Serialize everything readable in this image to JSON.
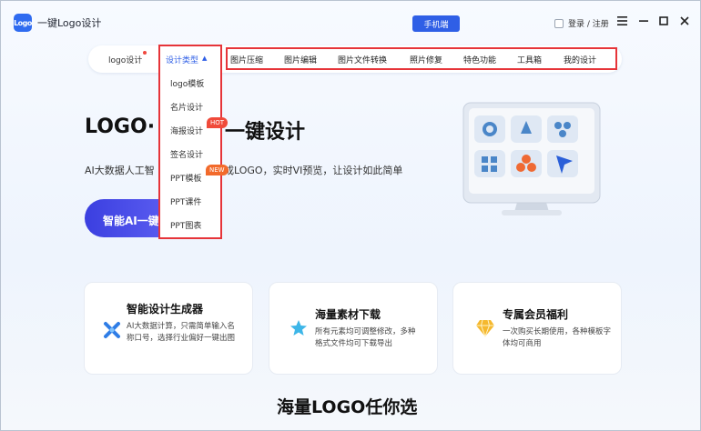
{
  "app": {
    "logo_badge": "Logo",
    "title": "一键Logo设计"
  },
  "header": {
    "mobile_button": "手机端",
    "login": "登录 / 注册"
  },
  "nav": {
    "logo_design": "logo设计",
    "design_type": "设计类型",
    "items": [
      "图片压缩",
      "图片编辑",
      "图片文件转换",
      "照片修复",
      "特色功能",
      "工具箱",
      "我的设计"
    ]
  },
  "dropdown": {
    "items": [
      "logo模板",
      "名片设计",
      "海报设计",
      "签名设计",
      "PPT模板",
      "PPT课件",
      "PPT图表"
    ],
    "badge_hot": "HOT",
    "badge_new": "NEW"
  },
  "hero": {
    "title_part1": "LOGO·",
    "title_part2": "一键设计",
    "subtitle_part1": "AI大数据人工智",
    "subtitle_part2": "成LOGO，实时VI预览，让设计如此简单",
    "ai_button": "智能AI一键"
  },
  "cards": [
    {
      "title": "智能设计生成器",
      "desc": "AI大数据计算，只需简单输入名称口号，选择行业偏好一键出图",
      "icon": "x-sparkle-icon"
    },
    {
      "title": "海量素材下载",
      "desc": "所有元素均可调整修改，多种格式文件均可下载导出",
      "icon": "star-icon"
    },
    {
      "title": "专属会员福利",
      "desc": "一次购买长期使用，各种模板字体均可商用",
      "icon": "diamond-icon"
    }
  ],
  "bottom_title": "海量LOGO任你选",
  "colors": {
    "accent": "#2f5fe6",
    "highlight": "#e63439",
    "hot": "#f04a3a",
    "new": "#f26a2b"
  }
}
